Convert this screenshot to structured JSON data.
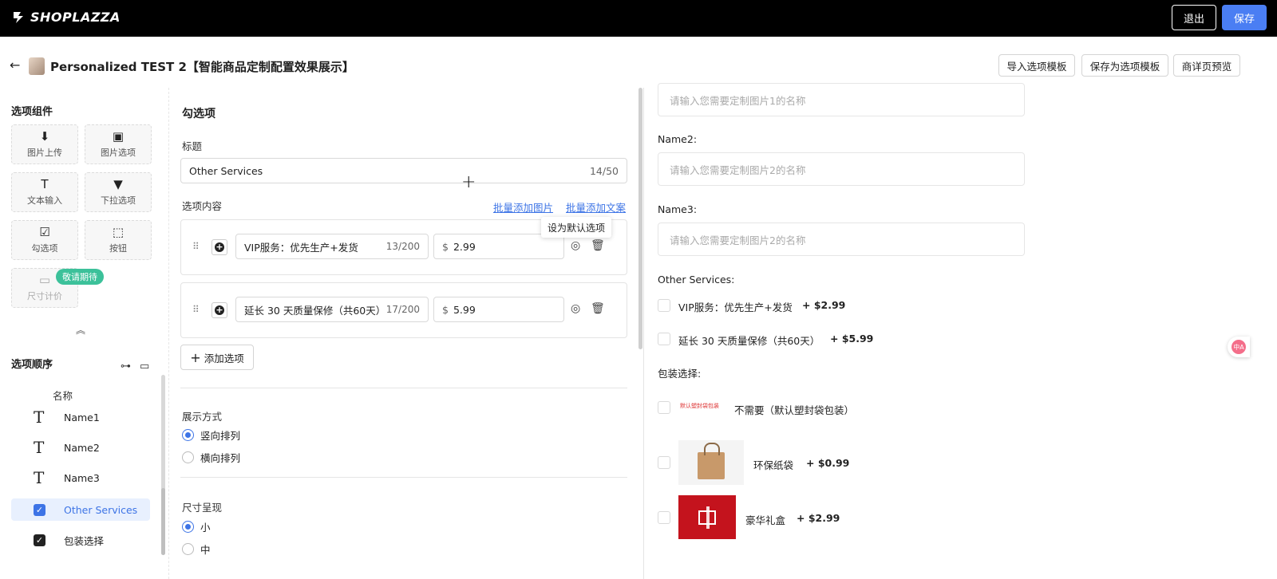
{
  "topbar": {
    "brand": "SHOPLAZZA",
    "exit_label": "退出",
    "save_label": "保存"
  },
  "header": {
    "title": "Personalized TEST 2【智能商品定制配置效果展示】",
    "buttons": [
      "导入选项模板",
      "保存为选项模板",
      "商详页预览"
    ]
  },
  "left": {
    "components_title": "选项组件",
    "components": [
      {
        "label": "图片上传",
        "icon": "image-upload-icon"
      },
      {
        "label": "图片选项",
        "icon": "image-options-icon"
      },
      {
        "label": "文本输入",
        "icon": "text-input-icon"
      },
      {
        "label": "下拉选项",
        "icon": "dropdown-icon"
      },
      {
        "label": "勾选项",
        "icon": "checkbox-icon"
      },
      {
        "label": "按钮",
        "icon": "button-click-icon"
      },
      {
        "label": "尺寸计价",
        "icon": "ruler-icon"
      }
    ],
    "coming_soon": "敬请期待",
    "order_title": "选项顺序",
    "column_header": "名称",
    "order_items": [
      {
        "label": "Name1",
        "type": "text"
      },
      {
        "label": "Name2",
        "type": "text"
      },
      {
        "label": "Name3",
        "type": "text"
      },
      {
        "label": "Other Services",
        "type": "check",
        "active": true
      },
      {
        "label": "包装选择",
        "type": "check"
      }
    ]
  },
  "editor": {
    "section_title": "勾选项",
    "title_label": "标题",
    "title_value": "Other Services",
    "title_count": "14/50",
    "content_label": "选项内容",
    "bulk_add_images": "批量添加图片",
    "bulk_add_text": "批量添加文案",
    "tooltip": "设为默认选项",
    "options": [
      {
        "name": "VIP服务：优先生产+发货",
        "count": "13/200",
        "currency": "$",
        "price": "2.99"
      },
      {
        "name": "延长 30 天质量保修（共60天）",
        "count": "17/200",
        "currency": "$",
        "price": "5.99"
      }
    ],
    "add_option": "添加选项",
    "display_label": "展示方式",
    "display_options": [
      {
        "label": "竖向排列",
        "selected": true
      },
      {
        "label": "横向排列",
        "selected": false
      }
    ],
    "size_label": "尺寸呈现",
    "size_options": [
      {
        "label": "小",
        "selected": true
      },
      {
        "label": "中",
        "selected": false
      }
    ]
  },
  "preview": {
    "input1_placeholder": "请输入您需要定制图片1的名称",
    "name2_label": "Name2:",
    "input2_placeholder": "请输入您需要定制图片2的名称",
    "name3_label": "Name3:",
    "input3_placeholder": "请输入您需要定制图片2的名称",
    "services_label": "Other Services:",
    "services": [
      {
        "label": "VIP服务：优先生产+发货",
        "price": "+ $2.99"
      },
      {
        "label": "延长 30 天质量保修（共60天）",
        "price": "+ $5.99"
      }
    ],
    "packaging_label": "包装选择:",
    "packaging": [
      {
        "label": "不需要（默认塑封袋包装）",
        "image_text": "默认塑封袋包装"
      },
      {
        "label": "环保纸袋",
        "price": "+ $0.99"
      },
      {
        "label": "豪华礼盒",
        "price": "+ $2.99"
      }
    ]
  },
  "translate_badge": "中A",
  "colors": {
    "accent": "#4a7ef3",
    "topbar": "#000000",
    "badge": "#3cc19a",
    "link": "#3d74e6"
  }
}
